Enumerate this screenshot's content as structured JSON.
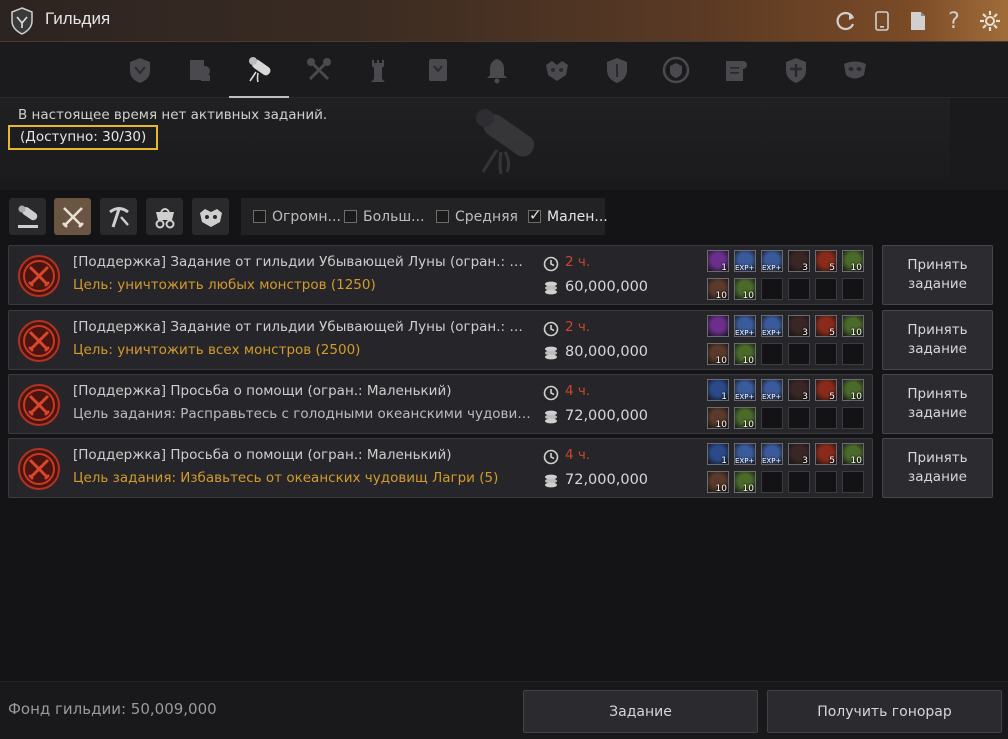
{
  "window": {
    "title": "Гильдия"
  },
  "title_icons": [
    "refresh-icon",
    "phone-icon",
    "document-icon",
    "help-icon",
    "settings-icon"
  ],
  "tabs": [
    {
      "name": "guild-info-tab",
      "active": false
    },
    {
      "name": "members-tab",
      "active": false
    },
    {
      "name": "quests-tab",
      "active": true
    },
    {
      "name": "war-tab",
      "active": false
    },
    {
      "name": "castle-tab",
      "active": false
    },
    {
      "name": "notice-tab",
      "active": false
    },
    {
      "name": "alert-tab",
      "active": false
    },
    {
      "name": "boss-tab",
      "active": false
    },
    {
      "name": "shield-tab",
      "active": false
    },
    {
      "name": "crest-tab",
      "active": false
    },
    {
      "name": "contract-tab",
      "active": false
    },
    {
      "name": "alliance-tab",
      "active": false
    },
    {
      "name": "mask-tab",
      "active": false
    }
  ],
  "info": {
    "message": "В настоящее время нет активных заданий.",
    "available": "(Доступно: 30/30)"
  },
  "filters": {
    "types": [
      {
        "name": "filter-all-icon",
        "active": false
      },
      {
        "name": "filter-combat-icon",
        "active": true
      },
      {
        "name": "filter-gathering-icon",
        "active": false
      },
      {
        "name": "filter-trade-icon",
        "active": false
      },
      {
        "name": "filter-monster-icon",
        "active": false
      }
    ],
    "sizes": [
      {
        "label": "Огромн...",
        "checked": false
      },
      {
        "label": "Больш...",
        "checked": false
      },
      {
        "label": "Средняя",
        "checked": false
      },
      {
        "label": "Мален...",
        "checked": true
      }
    ]
  },
  "quests": [
    {
      "title": "[Поддержка] Задание от гильдии Убывающей Луны (огран.: Ма...",
      "goal": "Цель: уничтожить любых монстров (1250)",
      "goal_color": "gold",
      "time": "2 ч.",
      "money": "60,000,000",
      "rewards_top": [
        {
          "icon": "purple-crystal",
          "count": "1",
          "color": "#6b2e8a"
        },
        {
          "icon": "exp-scroll",
          "count": "EXP+",
          "color": "#3a5a9a"
        },
        {
          "icon": "exp-scroll",
          "count": "EXP+",
          "color": "#3a5a9a"
        },
        {
          "icon": "red-orb",
          "count": "3",
          "color": "#3a2626"
        },
        {
          "icon": "fire-orb",
          "count": "5",
          "color": "#8a2a1a"
        },
        {
          "icon": "green-potion",
          "count": "10",
          "color": "#4a6a2a"
        }
      ],
      "rewards_bottom": [
        {
          "icon": "red-potion",
          "count": "10",
          "color": "#5a3a2a"
        },
        {
          "icon": "green-potion",
          "count": "10",
          "color": "#4a6a2a"
        }
      ],
      "accept_label": "Принять задание"
    },
    {
      "title": "[Поддержка] Задание от гильдии Убывающей Луны (огран.: Ма...",
      "goal": "Цель: уничтожить всех монстров (2500)",
      "goal_color": "gold",
      "time": "2 ч.",
      "money": "80,000,000",
      "rewards_top": [
        {
          "icon": "purple-crystal",
          "count": "",
          "color": "#6b2e8a"
        },
        {
          "icon": "exp-scroll",
          "count": "EXP+",
          "color": "#3a5a9a"
        },
        {
          "icon": "exp-scroll",
          "count": "EXP+",
          "color": "#3a5a9a"
        },
        {
          "icon": "red-orb",
          "count": "3",
          "color": "#3a2626"
        },
        {
          "icon": "fire-orb",
          "count": "5",
          "color": "#8a2a1a"
        },
        {
          "icon": "green-potion",
          "count": "10",
          "color": "#4a6a2a"
        }
      ],
      "rewards_bottom": [
        {
          "icon": "red-potion",
          "count": "10",
          "color": "#5a3a2a"
        },
        {
          "icon": "green-potion",
          "count": "10",
          "color": "#4a6a2a"
        }
      ],
      "accept_label": "Принять задание"
    },
    {
      "title": "[Поддержка] Просьба о помощи (огран.: Маленький)",
      "goal": "Цель задания: Расправьтесь с голодными океанскими чудовищ...",
      "goal_color": "grey",
      "time": "4 ч.",
      "money": "72,000,000",
      "rewards_top": [
        {
          "icon": "blue-crystal",
          "count": "1",
          "color": "#2a4a8a"
        },
        {
          "icon": "exp-scroll",
          "count": "EXP+",
          "color": "#3a5a9a"
        },
        {
          "icon": "exp-scroll",
          "count": "EXP+",
          "color": "#3a5a9a"
        },
        {
          "icon": "red-orb",
          "count": "3",
          "color": "#3a2626"
        },
        {
          "icon": "fire-orb",
          "count": "5",
          "color": "#8a2a1a"
        },
        {
          "icon": "green-potion",
          "count": "10",
          "color": "#4a6a2a"
        }
      ],
      "rewards_bottom": [
        {
          "icon": "red-potion",
          "count": "10",
          "color": "#5a3a2a"
        },
        {
          "icon": "green-potion",
          "count": "10",
          "color": "#4a6a2a"
        }
      ],
      "accept_label": "Принять задание"
    },
    {
      "title": "[Поддержка] Просьба о помощи (огран.: Маленький)",
      "goal": "Цель задания: Избавьтесь от океанских чудовищ Лагри (5)",
      "goal_color": "gold",
      "time": "4 ч.",
      "money": "72,000,000",
      "rewards_top": [
        {
          "icon": "blue-crystal",
          "count": "1",
          "color": "#2a4a8a"
        },
        {
          "icon": "exp-scroll",
          "count": "EXP+",
          "color": "#3a5a9a"
        },
        {
          "icon": "exp-scroll",
          "count": "EXP+",
          "color": "#3a5a9a"
        },
        {
          "icon": "red-orb",
          "count": "3",
          "color": "#3a2626"
        },
        {
          "icon": "fire-orb",
          "count": "5",
          "color": "#8a2a1a"
        },
        {
          "icon": "green-potion",
          "count": "10",
          "color": "#4a6a2a"
        }
      ],
      "rewards_bottom": [
        {
          "icon": "red-potion",
          "count": "10",
          "color": "#5a3a2a"
        },
        {
          "icon": "green-potion",
          "count": "10",
          "color": "#4a6a2a"
        }
      ],
      "accept_label": "Принять задание"
    }
  ],
  "footer": {
    "fund_label": "Фонд гильдии:",
    "fund_value": "50,009,000",
    "quest_button": "Задание",
    "fee_button": "Получить гонорар"
  },
  "colors": {
    "accent_gold": "#d39a2c",
    "time_red": "#c9452f",
    "highlight_yellow": "#e6b82c"
  }
}
